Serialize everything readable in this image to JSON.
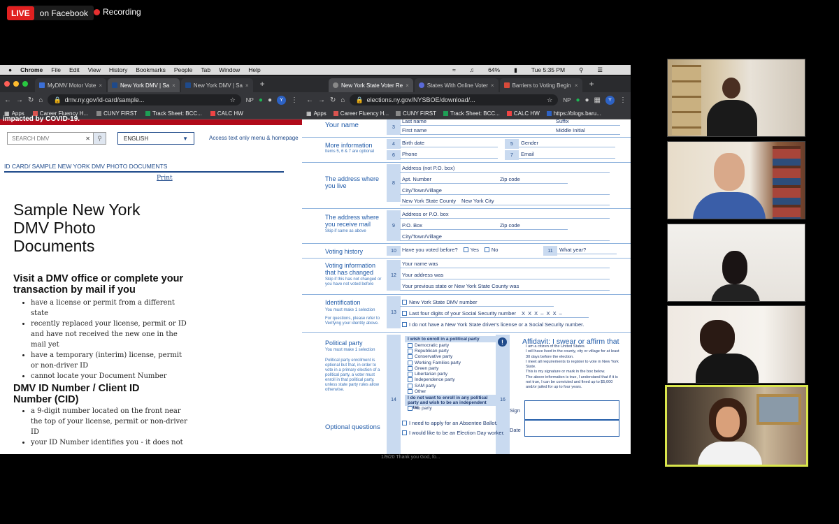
{
  "stream": {
    "live_label": "LIVE",
    "platform": "on Facebook",
    "recording": "Recording"
  },
  "menubar": {
    "items": [
      "Chrome",
      "File",
      "Edit",
      "View",
      "History",
      "Bookmarks",
      "People",
      "Tab",
      "Window",
      "Help"
    ],
    "battery": "64%",
    "clock": "Tue 5:35 PM"
  },
  "left_browser": {
    "tabs": [
      "MyDMV Motor Vote",
      "New York DMV | Sa",
      "New York DMV | Sa"
    ],
    "url": "dmv.ny.gov/id-card/sample...",
    "bookmarks": [
      "Apps",
      "Career Fluency H...",
      "CUNY FIRST",
      "Track Sheet: BCC...",
      "CALC HW"
    ],
    "page": {
      "banner_text": "impacted by COVID-19.",
      "search_placeholder": "SEARCH DMV",
      "language": "ENGLISH",
      "access_link": "Access text only menu & homepage",
      "breadcrumb": "ID CARD/ SAMPLE NEW YORK DMV PHOTO DOCUMENTS",
      "print": "Print",
      "title": "Sample New York DMV Photo Documents",
      "section1_heading": "Visit a DMV office or complete your transaction by mail if you",
      "section1_items": [
        "have a license or permit from a different state",
        "recently replaced your license, permit or ID and have not received the new one in the mail yet",
        "have a temporary (interim) license, permit or non-driver ID",
        "cannot locate your Document Number"
      ],
      "section2_heading": "DMV ID Number / Client ID Number (CID)",
      "section2_items": [
        "a 9-digit number located on the front near the top of your license, permit or non-driver ID",
        "your ID Number identifies you - it does not"
      ]
    }
  },
  "right_browser": {
    "tabs": [
      "New York State Voter Re",
      "States With Online Voter",
      "Barriers to Voting Begin"
    ],
    "url": "elections.ny.gov/NYSBOE/download/...",
    "bookmarks": [
      "Apps",
      "Career Fluency H...",
      "CUNY FIRST",
      "Track Sheet: BCC...",
      "CALC HW",
      "https://blogs.baru..."
    ],
    "form": {
      "your_name": {
        "label": "Your name",
        "num": "3",
        "fields": [
          "Last name",
          "First name",
          "Suffix",
          "Middle Initial"
        ]
      },
      "more_info": {
        "label": "More information",
        "sub": "Items 5, 6 & 7 are optional",
        "num4": "4",
        "birth": "Birth date",
        "num5": "5",
        "gender": "Gender",
        "num6": "6",
        "phone": "Phone",
        "num7": "7",
        "email": "Email"
      },
      "address": {
        "label": "The address where you live",
        "num": "8",
        "fields": [
          "Address (not P.O. box)",
          "Apt. Number",
          "Zip code",
          "City/Town/Village",
          "New York State County"
        ],
        "county_value": "New York City"
      },
      "mail": {
        "label": "The address where you receive mail",
        "sub": "Skip if same as above",
        "num": "9",
        "fields": [
          "Address or P.O. box",
          "P.O. Box",
          "Zip code",
          "City/Town/Village"
        ]
      },
      "history": {
        "label": "Voting history",
        "num": "10",
        "question": "Have you voted before?",
        "yes": "Yes",
        "no": "No",
        "num11": "11",
        "what_year": "What year?"
      },
      "changed": {
        "label": "Voting information that has changed",
        "sub": "Skip if this has not changed or you have not voted before",
        "num": "12",
        "fields": [
          "Your name was",
          "Your address was",
          "Your previous state or New York State County was"
        ]
      },
      "identification": {
        "label": "Identification",
        "sub": "You must make 1 selection",
        "sub2": "For questions, please refer to Verifying your identity above.",
        "num": "13",
        "options": [
          "New York State DMV number",
          "Last four digits of your Social Security number",
          "I do not have a New York State driver's license or a Social Security number."
        ],
        "ssn_mask": "X X X – X X –"
      },
      "party": {
        "label": "Political party",
        "sub": "You must make 1 selection",
        "sub2": "Political party enrollment is optional but that, in order to vote in a primary election of a political party, a voter must enroll in that political party, unless state party rules allow otherwise.",
        "num": "14",
        "header": "I wish to enroll in a political party",
        "options": [
          "Democratic party",
          "Republican party",
          "Conservative party",
          "Working Families party",
          "Green party",
          "Libertarian party",
          "Independence party",
          "SAM party",
          "Other"
        ],
        "none_header": "I do not want to enroll in any political party and wish to be an independent voter",
        "no_party": "No party"
      },
      "affidavit": {
        "num": "16",
        "title": "Affidavit: I swear or affirm that",
        "items": [
          "I am a citizen of the United States.",
          "I will have lived in the county, city or village for at least 30 days before the election.",
          "I meet all requirements to register to vote in New York State.",
          "This is my signature or mark in the box below.",
          "The above information is true, I understand that if it is not true, I can be convicted and fined up to $5,000 and/or jailed for up to four years."
        ],
        "sign": "Sign",
        "date": "Date"
      },
      "optional": {
        "label": "Optional questions",
        "num": "15",
        "options": [
          "I need to apply for an Absentee Ballot.",
          "I would like to be an Election Day worker."
        ]
      }
    }
  },
  "bottom_strip": "1/9/20   Thank you God, fo..."
}
